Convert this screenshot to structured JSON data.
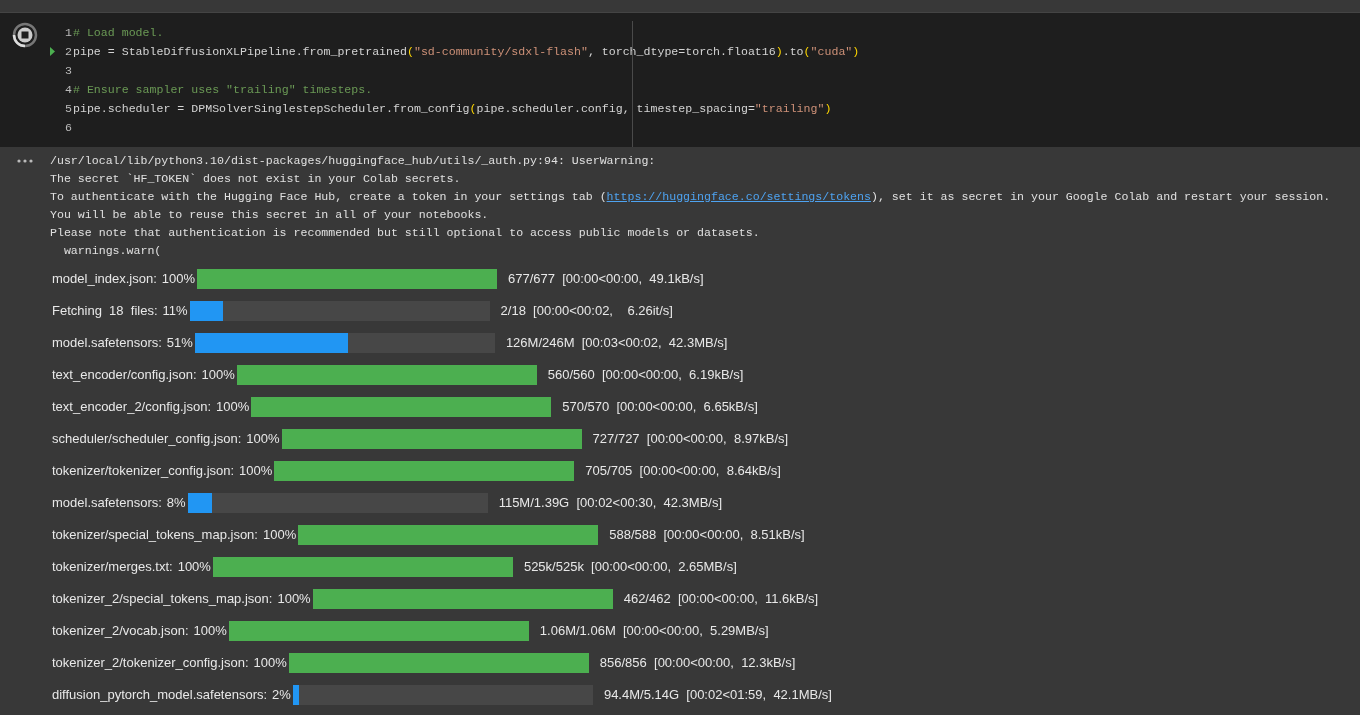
{
  "code_cell": {
    "running": true,
    "lines": [
      {
        "number": "1",
        "current": false,
        "tokens": [
          {
            "kind": "comment",
            "text": "# Load model."
          }
        ]
      },
      {
        "number": "2",
        "current": true,
        "tokens": [
          {
            "kind": "plain",
            "text": "pipe = StableDiffusionXLPipeline.from_pretrained"
          },
          {
            "kind": "bracket",
            "text": "("
          },
          {
            "kind": "string",
            "text": "\"sd-community/sdxl-flash\""
          },
          {
            "kind": "plain",
            "text": ", torch_dtype=torch.float16"
          },
          {
            "kind": "bracket",
            "text": ")"
          },
          {
            "kind": "plain",
            "text": ".to"
          },
          {
            "kind": "bracket",
            "text": "("
          },
          {
            "kind": "string",
            "text": "\"cuda\""
          },
          {
            "kind": "bracket",
            "text": ")"
          }
        ]
      },
      {
        "number": "3",
        "current": false
      },
      {
        "number": "4",
        "current": false,
        "tokens": [
          {
            "kind": "comment",
            "text": "# Ensure sampler uses \"trailing\" timesteps."
          }
        ]
      },
      {
        "number": "5",
        "current": false,
        "tokens": [
          {
            "kind": "plain",
            "text": "pipe.scheduler = DPMSolverSinglestepScheduler.from_config"
          },
          {
            "kind": "bracket",
            "text": "("
          },
          {
            "kind": "plain",
            "text": "pipe.scheduler.config, timestep_spacing="
          },
          {
            "kind": "string",
            "text": "\"trailing\""
          },
          {
            "kind": "bracket",
            "text": ")"
          }
        ]
      },
      {
        "number": "6",
        "current": false
      }
    ]
  },
  "output": {
    "lines": [
      [
        {
          "kind": "text",
          "text": "/usr/local/lib/python3.10/dist-packages/huggingface_hub/utils/_auth.py:94: UserWarning:"
        }
      ],
      [
        {
          "kind": "text",
          "text": "The secret `HF_TOKEN` does not exist in your Colab secrets."
        }
      ],
      [
        {
          "kind": "text",
          "text": "To authenticate with the Hugging Face Hub, create a token in your settings tab ("
        },
        {
          "kind": "link",
          "text": "https://huggingface.co/settings/tokens"
        },
        {
          "kind": "text",
          "text": "), set it as secret in your Google Colab and restart your session."
        }
      ],
      [
        {
          "kind": "text",
          "text": "You will be able to reuse this secret in all of your notebooks."
        }
      ],
      [
        {
          "kind": "text",
          "text": "Please note that authentication is recommended but still optional to access public models or datasets."
        }
      ],
      [
        {
          "kind": "text",
          "text": "  warnings.warn("
        }
      ]
    ]
  },
  "progress": [
    {
      "label": "model_index.json:",
      "percent": "100%",
      "level": 1,
      "color": "#4caf50",
      "stats": "677/677  [00:00<00:00,  49.1kB/s]"
    },
    {
      "label": "Fetching  18  files:",
      "percent": "11%",
      "level": 0.11,
      "color": "#2196f3",
      "stats": "2/18  [00:00<00:02,    6.26it/s]"
    },
    {
      "label": "model.safetensors:",
      "percent": "51%",
      "level": 0.51,
      "color": "#2196f3",
      "stats": "126M/246M  [00:03<00:02,  42.3MB/s]"
    },
    {
      "label": "text_encoder/config.json:",
      "percent": "100%",
      "level": 1,
      "color": "#4caf50",
      "stats": "560/560  [00:00<00:00,  6.19kB/s]"
    },
    {
      "label": "text_encoder_2/config.json:",
      "percent": "100%",
      "level": 1,
      "color": "#4caf50",
      "stats": "570/570  [00:00<00:00,  6.65kB/s]"
    },
    {
      "label": "scheduler/scheduler_config.json:",
      "percent": "100%",
      "level": 1,
      "color": "#4caf50",
      "stats": "727/727  [00:00<00:00,  8.97kB/s]"
    },
    {
      "label": "tokenizer/tokenizer_config.json:",
      "percent": "100%",
      "level": 1,
      "color": "#4caf50",
      "stats": "705/705  [00:00<00:00,  8.64kB/s]"
    },
    {
      "label": "model.safetensors:",
      "percent": "8%",
      "level": 0.08,
      "color": "#2196f3",
      "stats": "115M/1.39G  [00:02<00:30,  42.3MB/s]"
    },
    {
      "label": "tokenizer/special_tokens_map.json:",
      "percent": "100%",
      "level": 1,
      "color": "#4caf50",
      "stats": "588/588  [00:00<00:00,  8.51kB/s]"
    },
    {
      "label": "tokenizer/merges.txt:",
      "percent": "100%",
      "level": 1,
      "color": "#4caf50",
      "stats": "525k/525k  [00:00<00:00,  2.65MB/s]"
    },
    {
      "label": "tokenizer_2/special_tokens_map.json:",
      "percent": "100%",
      "level": 1,
      "color": "#4caf50",
      "stats": "462/462  [00:00<00:00,  11.6kB/s]"
    },
    {
      "label": "tokenizer_2/vocab.json:",
      "percent": "100%",
      "level": 1,
      "color": "#4caf50",
      "stats": "1.06M/1.06M  [00:00<00:00,  5.29MB/s]"
    },
    {
      "label": "tokenizer_2/tokenizer_config.json:",
      "percent": "100%",
      "level": 1,
      "color": "#4caf50",
      "stats": "856/856  [00:00<00:00,  12.3kB/s]"
    },
    {
      "label": "diffusion_pytorch_model.safetensors:",
      "percent": "2%",
      "level": 0.02,
      "color": "#2196f3",
      "stats": "94.4M/5.14G  [00:02<01:59,  42.1MB/s]"
    }
  ]
}
